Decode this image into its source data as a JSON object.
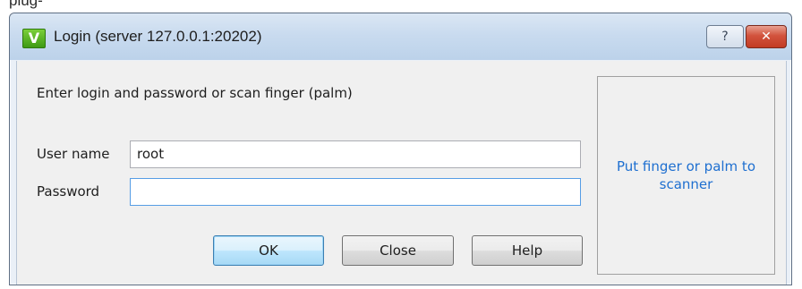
{
  "background": {
    "partial_text": "plug-"
  },
  "window": {
    "title": "Login (server 127.0.0.1:20202)",
    "app_icon_glyph": "V",
    "help_glyph": "?",
    "close_glyph": "✕"
  },
  "form": {
    "prompt": "Enter login and password or scan finger (palm)",
    "username_label": "User name",
    "username_value": "root",
    "password_label": "Password",
    "password_value": ""
  },
  "buttons": {
    "ok": "OK",
    "close": "Close",
    "help": "Help"
  },
  "scanner": {
    "message": "Put finger or palm to scanner"
  },
  "colors": {
    "scanner_text": "#1e6fd0",
    "close_button": "#c23b23",
    "default_button_border": "#3c7fb1"
  }
}
